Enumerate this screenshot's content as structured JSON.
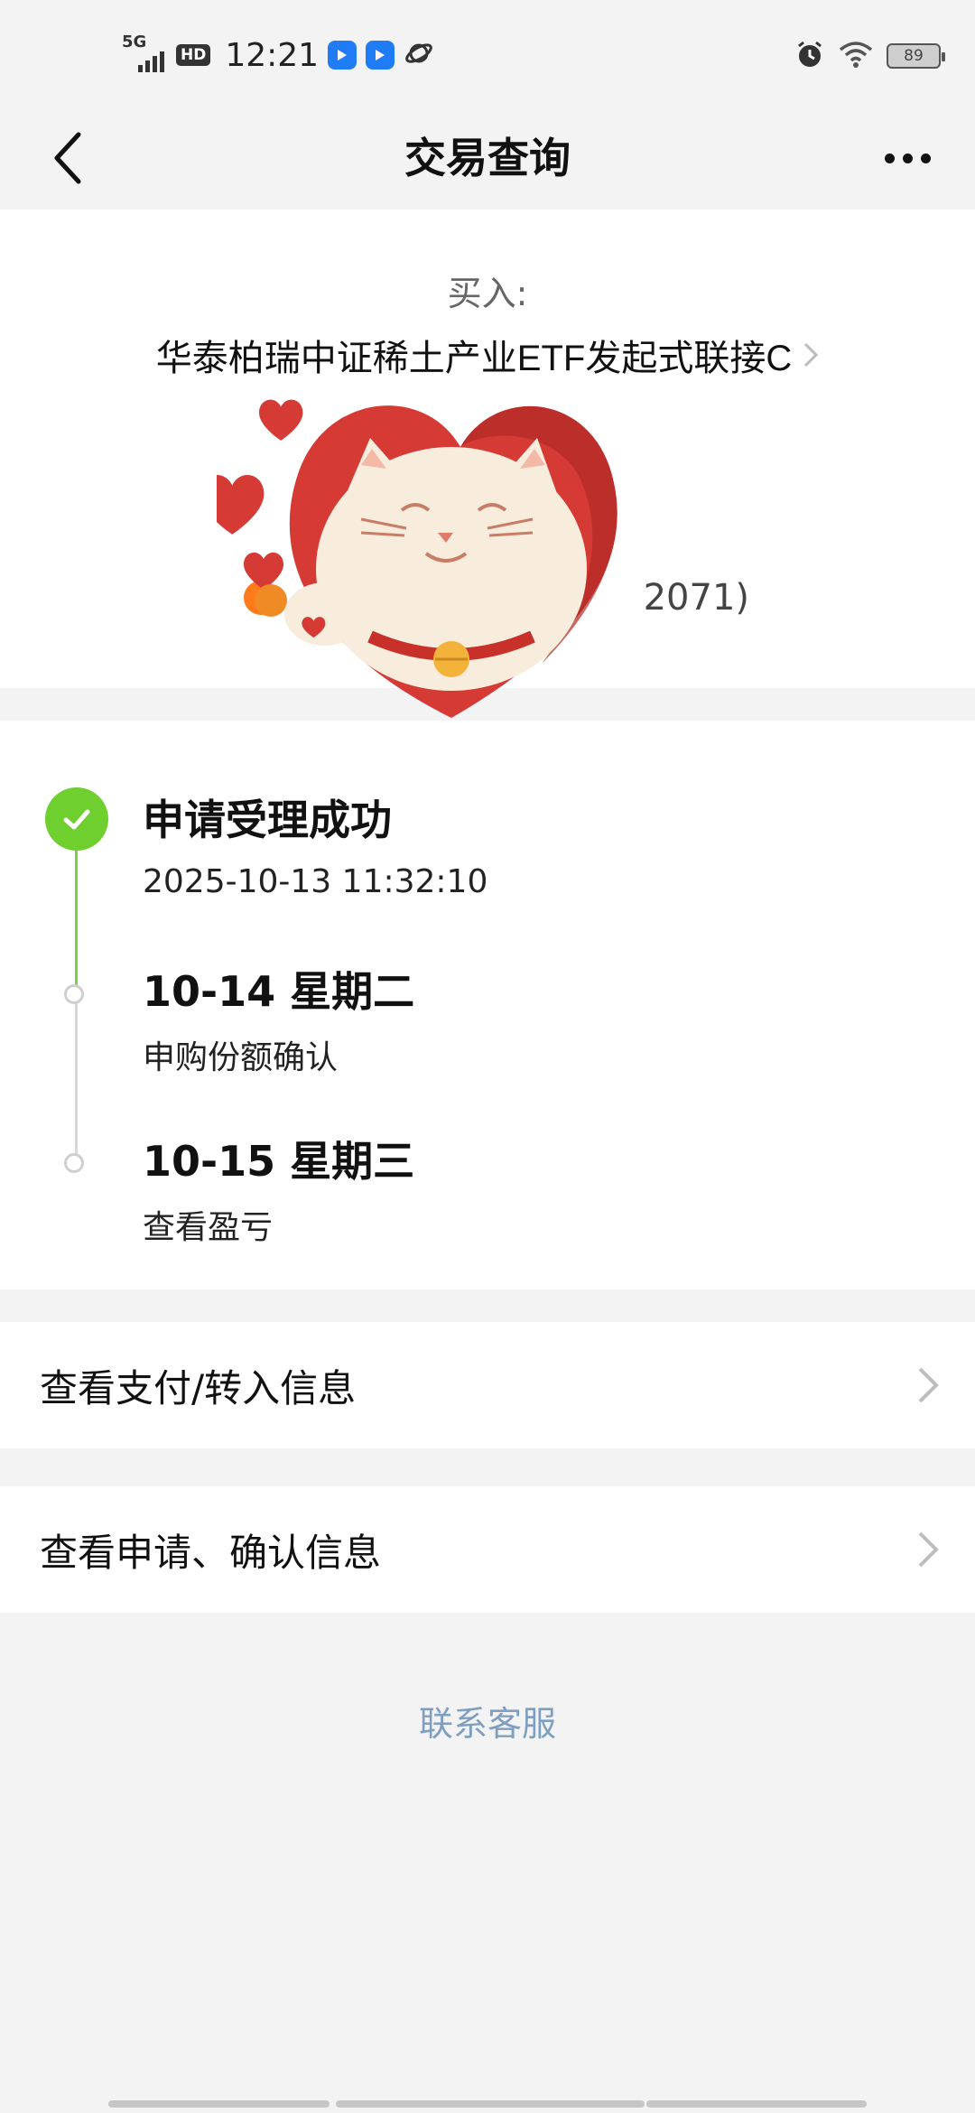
{
  "status_bar": {
    "network": "5G",
    "hd": "HD",
    "time": "12:21",
    "battery": "89"
  },
  "header": {
    "title": "交易查询"
  },
  "buy_card": {
    "label": "买入:",
    "fund_name": "华泰柏瑞中证稀土产业ETF发起式联接C",
    "payment_partial": "2071)"
  },
  "timeline": {
    "steps": [
      {
        "title": "申请受理成功",
        "sub": "2025-10-13 11:32:10",
        "status": "done"
      },
      {
        "title": "10-14 星期二",
        "sub": "申购份额确认",
        "status": "pending"
      },
      {
        "title": "10-15 星期三",
        "sub": "查看盈亏",
        "status": "pending"
      }
    ]
  },
  "links": {
    "payment_info": "查看支付/转入信息",
    "apply_confirm_info": "查看申请、确认信息"
  },
  "footer": {
    "contact": "联系客服"
  },
  "colors": {
    "success": "#6fcf2e",
    "link_blue": "#7f9fc0",
    "sticker_red": "#d63a34"
  }
}
